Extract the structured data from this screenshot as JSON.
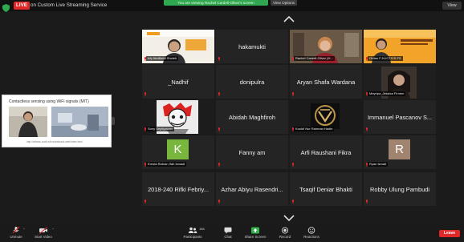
{
  "topbar": {
    "live_badge": "LIVE",
    "live_title": "on Custom Live Streaming Service",
    "share_banner": "You are viewing Rachel Cardell-Oliver's screen",
    "view_options": "View Options",
    "view_button": "View"
  },
  "shared_screen": {
    "title": "Contactless sensing using WiFi signals (MIT)",
    "caption": "http://witrack.csail.mit.edu/witrack-web/index.html"
  },
  "participants": [
    {
      "name": "Irfy Abdillatul Sholeh",
      "kind": "video-label"
    },
    {
      "name": "hakamukti",
      "kind": "name"
    },
    {
      "name": "Rachel Cardell-Oliver (H...",
      "kind": "video-label"
    },
    {
      "name": "Ordan F-N-ICTICS FS",
      "kind": "video-label"
    },
    {
      "name": "_Nadhif",
      "kind": "name"
    },
    {
      "name": "donipulra",
      "kind": "name"
    },
    {
      "name": "Aryan Shafa Wardana",
      "kind": "name"
    },
    {
      "name": "Meyripa_Jessica Firmen",
      "kind": "video-label"
    },
    {
      "name": "Sony Septiyawan",
      "kind": "video-label"
    },
    {
      "name": "Abidah Maghfiroh",
      "kind": "name"
    },
    {
      "name": "Kouldi Nur Rahman Hadie",
      "kind": "video-label"
    },
    {
      "name": "Immanuel Pascanov S...",
      "kind": "name"
    },
    {
      "name": "Eresta Ratnan Ifah Ismadi",
      "kind": "avatar",
      "initial": "K"
    },
    {
      "name": "Fanny am",
      "kind": "name"
    },
    {
      "name": "Arfi Raushani Fikra",
      "kind": "name"
    },
    {
      "name": "Ryan Ismail",
      "kind": "avatar",
      "initial": "R"
    },
    {
      "name": "2018-240 Rifki Febriy...",
      "kind": "name"
    },
    {
      "name": "Azhar Abiyu Rasendri...",
      "kind": "name"
    },
    {
      "name": "Tsaqif Deniar Bhakti",
      "kind": "name"
    },
    {
      "name": "Robby Ulung Pambudi",
      "kind": "name"
    }
  ],
  "toolbar": {
    "unmute": "Unmute",
    "start_video": "Start Video",
    "participants": "Participants",
    "participants_count": "186",
    "chat": "Chat",
    "share_screen": "Share Screen",
    "record": "Record",
    "reactions": "Reactions",
    "leave": "Leave"
  },
  "colors": {
    "live_red": "#e02828",
    "share_green": "#2fa84f",
    "leave_red": "#e02828",
    "avatar_k": "#79b63e",
    "avatar_r": "#a0846f"
  }
}
